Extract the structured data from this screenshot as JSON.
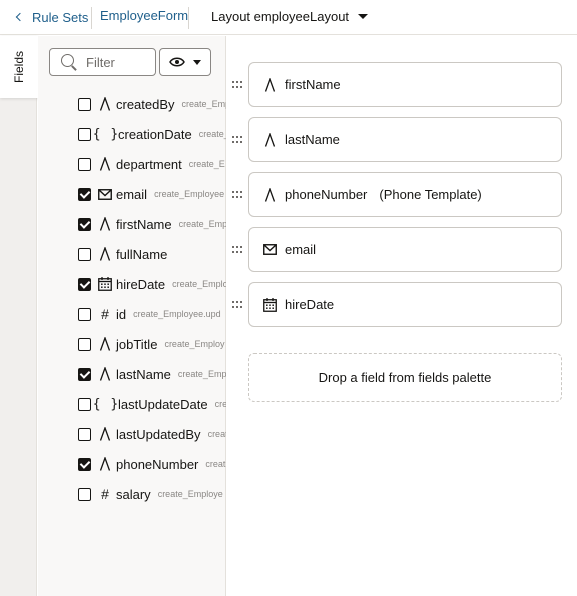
{
  "header": {
    "back_label": "Rule Sets",
    "form_label": "EmployeeForm",
    "layout_label": "Layout employeeLayout"
  },
  "sidebar": {
    "tab_label": "Fields"
  },
  "palette": {
    "filter_placeholder": "Filter",
    "visibility_icon": "eye-icon",
    "fields": [
      {
        "name": "createdBy",
        "source": "create_Emp",
        "type": "text",
        "checked": false
      },
      {
        "name": "creationDate",
        "source": "create_",
        "type": "object",
        "checked": false
      },
      {
        "name": "department",
        "source": "create_E",
        "type": "text",
        "checked": false
      },
      {
        "name": "email",
        "source": "create_Employee",
        "type": "email",
        "checked": true
      },
      {
        "name": "firstName",
        "source": "create_Emp",
        "type": "text",
        "checked": true
      },
      {
        "name": "fullName",
        "source": "",
        "type": "text",
        "checked": false
      },
      {
        "name": "hireDate",
        "source": "create_Emplo",
        "type": "date",
        "checked": true
      },
      {
        "name": "id",
        "source": "create_Employee.upd",
        "type": "number",
        "checked": false
      },
      {
        "name": "jobTitle",
        "source": "create_Employ",
        "type": "text",
        "checked": false
      },
      {
        "name": "lastName",
        "source": "create_Emp",
        "type": "text",
        "checked": true
      },
      {
        "name": "lastUpdateDate",
        "source": "crea",
        "type": "object",
        "checked": false
      },
      {
        "name": "lastUpdatedBy",
        "source": "creat",
        "type": "text",
        "checked": false
      },
      {
        "name": "phoneNumber",
        "source": "creat",
        "type": "text",
        "checked": true
      },
      {
        "name": "salary",
        "source": "create_Employe",
        "type": "number",
        "checked": false
      }
    ]
  },
  "layout": {
    "fields": [
      {
        "name": "firstName",
        "type": "text",
        "template": ""
      },
      {
        "name": "lastName",
        "type": "text",
        "template": ""
      },
      {
        "name": "phoneNumber",
        "type": "text",
        "template": "(Phone Template)"
      },
      {
        "name": "email",
        "type": "email",
        "template": ""
      },
      {
        "name": "hireDate",
        "type": "date",
        "template": ""
      }
    ],
    "dropzone_text": "Drop a field from fields palette"
  }
}
